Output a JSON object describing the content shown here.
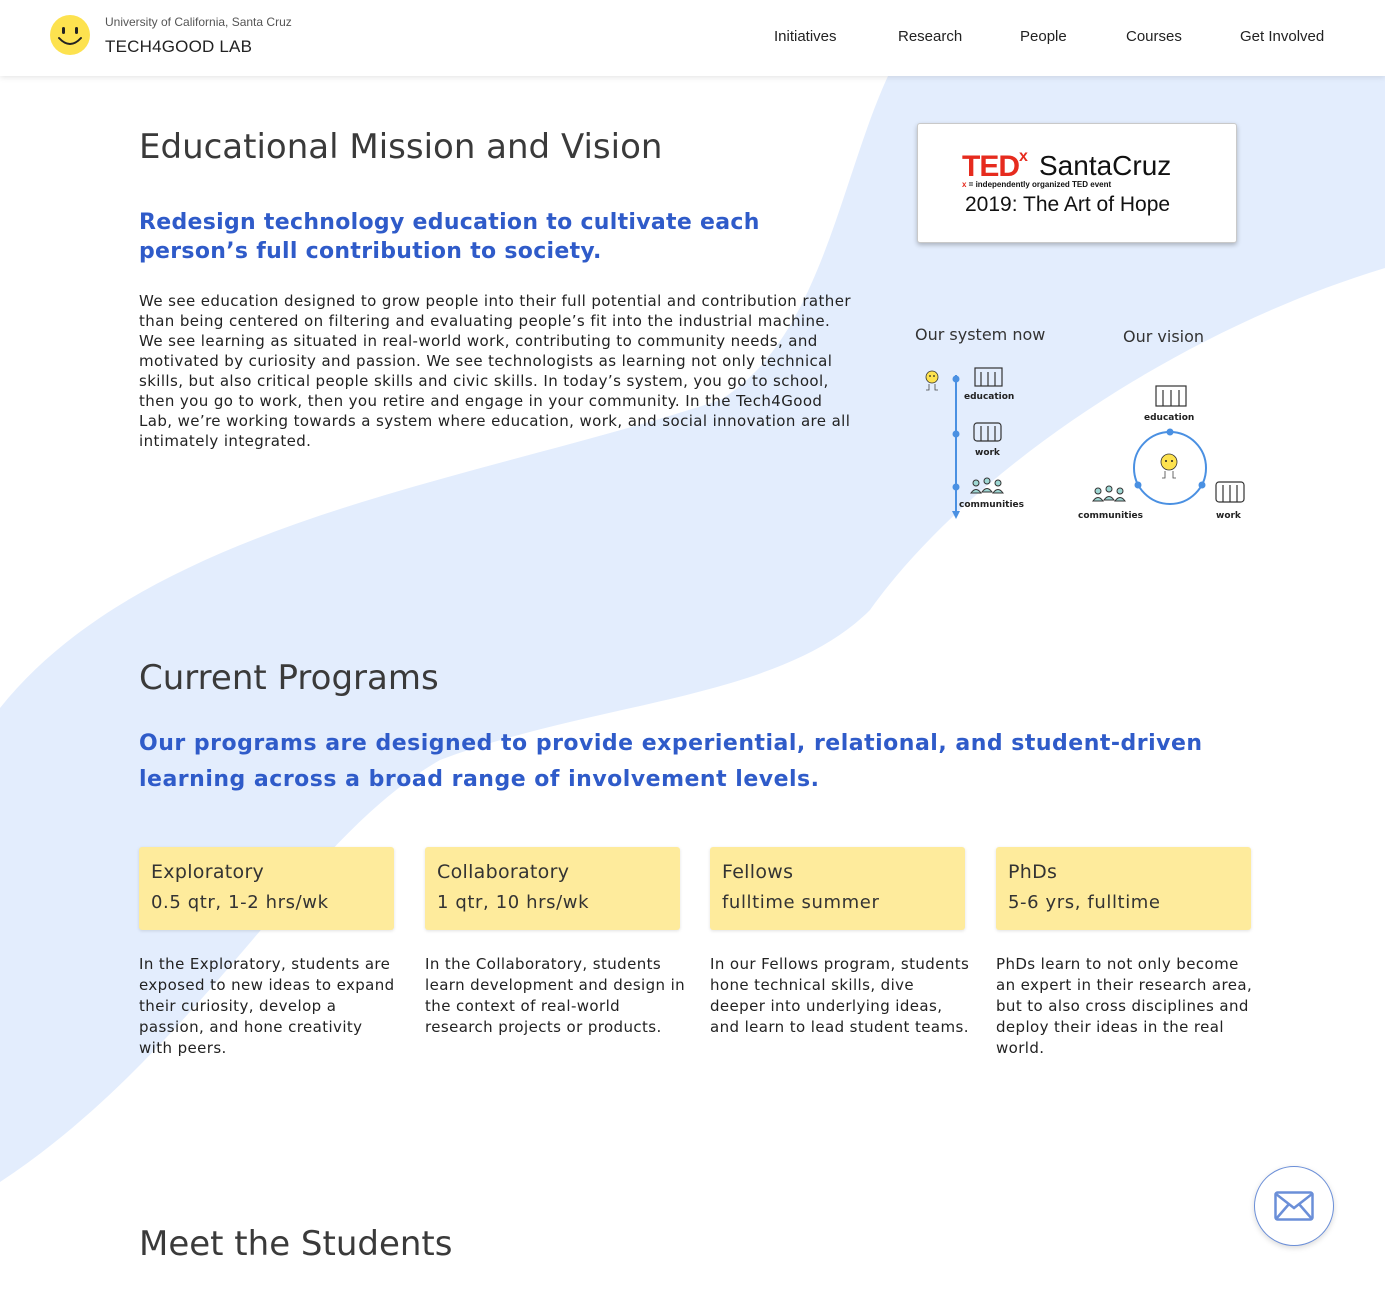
{
  "nav": {
    "university": "University of California, Santa Cruz",
    "lab_name": "TECH4GOOD LAB",
    "links": [
      "Initiatives",
      "Research",
      "People",
      "Courses",
      "Get Involved"
    ]
  },
  "mission": {
    "title": "Educational Mission and Vision",
    "subtitle": "Redesign technology education to cultivate each person’s full contribution to society.",
    "body": "We see education designed to grow people into their full potential and contribution rather than being centered on filtering and evaluating people’s fit into the industrial machine. We see learning as situated in real-world work, contributing to community needs, and motivated by curiosity and passion. We see technologists as learning not only technical skills, but also critical people skills and civic skills. In today’s system, you go to school, then you go to work, then you retire and engage in your community. In the Tech4Good Lab, we’re working towards a system where education, work, and social innovation are all intimately integrated."
  },
  "ted": {
    "logo": "TED",
    "x": "x",
    "city": "SantaCruz",
    "tagline_x": "x",
    "tagline": " = independently organized TED event",
    "year_title": "2019: The Art of Hope"
  },
  "diagram": {
    "now_title": "Our system now",
    "vision_title": "Our vision",
    "labels": {
      "education": "education",
      "work": "work",
      "communities": "communities"
    }
  },
  "programs": {
    "title": "Current Programs",
    "subtitle": "Our programs are designed to provide experiential, relational, and student-driven learning across a broad range of involvement levels.",
    "cards": [
      {
        "name": "Exploratory",
        "time": "0.5 qtr, 1-2 hrs/wk",
        "desc": "In the Exploratory, students are exposed to new ideas to expand their curiosity, develop a passion, and hone creativity with peers."
      },
      {
        "name": "Collaboratory",
        "time": "1 qtr, 10 hrs/wk",
        "desc": "In the Collaboratory, students learn development and design in the context of real-world research projects or products."
      },
      {
        "name": "Fellows",
        "time": "fulltime summer",
        "desc": "In our Fellows program, students hone technical skills, dive deeper into underlying ideas, and learn to lead student teams."
      },
      {
        "name": "PhDs",
        "time": "5-6 yrs, fulltime",
        "desc": "PhDs learn to not only become an expert in their research area, but to also cross disciplines and deploy their ideas in the real world."
      }
    ]
  },
  "students": {
    "title": "Meet the Students"
  },
  "colors": {
    "accent_blue": "#2f5bc9",
    "wave": "#e3edfd",
    "card_yellow": "#feeb9c",
    "smiley": "#fde24f"
  },
  "icons": {
    "logo": "smiley-icon",
    "contact": "mail-icon"
  }
}
